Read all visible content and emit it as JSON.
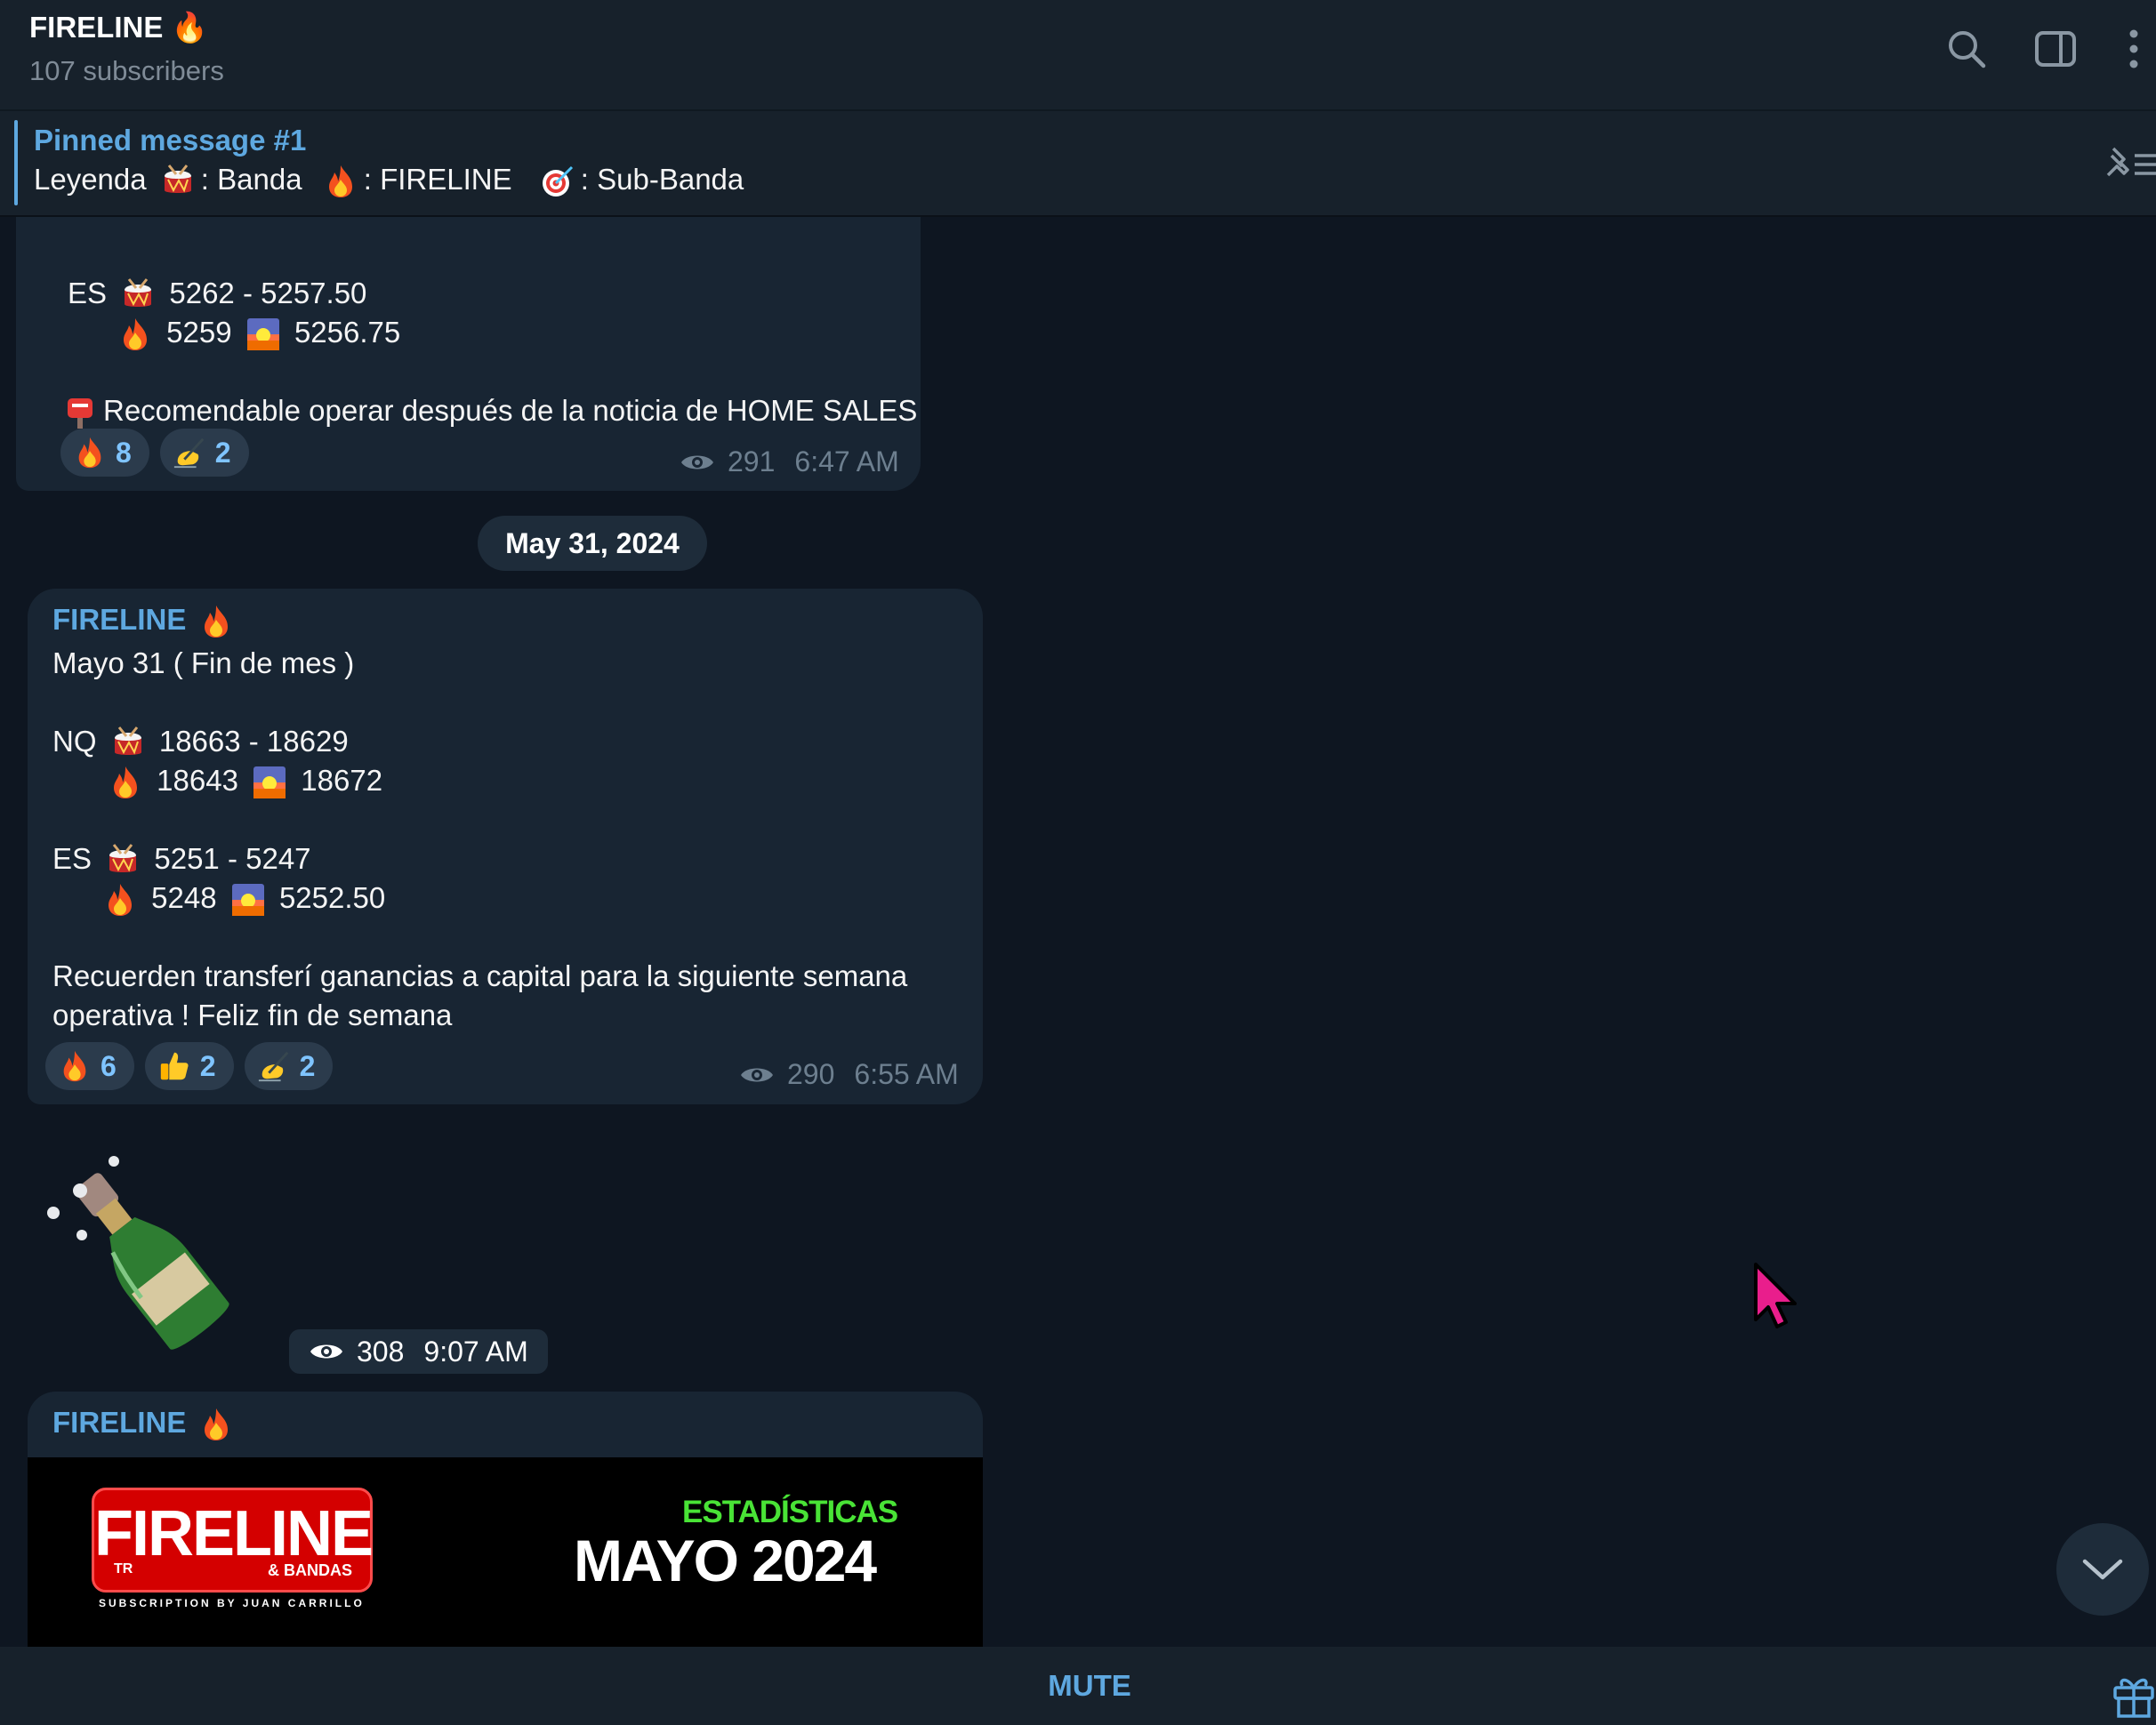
{
  "header": {
    "title": "FIRELINE 🔥",
    "subscribers": "107 subscribers"
  },
  "pinned": {
    "title": "Pinned message #1",
    "legend": "Leyenda",
    "band": ": Banda",
    "fireline": ": FIRELINE",
    "subband": ": Sub-Banda"
  },
  "messages": [
    {
      "lines": {
        "es_label": "ES",
        "es_range": "5262 - 5257.50",
        "es_fire": "5259",
        "es_sun": "5256.75",
        "note": "Recomendable operar después de la noticia de HOME SALES"
      },
      "reactions": [
        {
          "emoji": "fire",
          "count": "8"
        },
        {
          "emoji": "writing-hand",
          "count": "2"
        }
      ],
      "views": "291",
      "time": "6:47 AM"
    },
    {
      "sender": "FIRELINE",
      "lines": {
        "title": "Mayo 31 ( Fin de mes )",
        "nq_label": "NQ",
        "nq_range": "18663 - 18629",
        "nq_fire": "18643",
        "nq_sun": "18672",
        "es_label": "ES",
        "es_range": "5251 - 5247",
        "es_fire": "5248",
        "es_sun": "5252.50",
        "note1": "Recuerden transferí ganancias a capital para la siguiente semana",
        "note2": "operativa  ! Feliz fin de semana"
      },
      "reactions": [
        {
          "emoji": "fire",
          "count": "6"
        },
        {
          "emoji": "thumbs-up",
          "count": "2"
        },
        {
          "emoji": "writing-hand",
          "count": "2"
        }
      ],
      "views": "290",
      "time": "6:55 AM"
    }
  ],
  "date_separator": "May 31, 2024",
  "sticker": {
    "icon": "champagne-bottle-icon",
    "views": "308",
    "time": "9:07 AM"
  },
  "promo": {
    "sender": "FIRELINE",
    "logo_text": "FIRELINE",
    "logo_tr": "TR",
    "logo_bandas": "& BANDAS",
    "logo_subline": "SUBSCRIPTION BY JUAN CARRILLO",
    "stats_label": "ESTADÍSTICAS",
    "stats_title": "MAYO 2024"
  },
  "bottom": {
    "mute_label": "MUTE"
  },
  "colors": {
    "bg": "#0e1621",
    "panel": "#17212b",
    "bubble": "#182533",
    "accent": "#5ea8e0",
    "reaction_bg": "#2b3b4c"
  }
}
